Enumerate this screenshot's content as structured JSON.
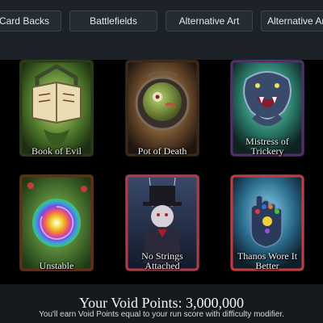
{
  "tabs": [
    "Card Backs",
    "Battlefields",
    "Alternative Art",
    "Alternative Art S"
  ],
  "cards": [
    {
      "title": "Book of Evil",
      "art": "evil-book-art",
      "color": "#6a9a3a"
    },
    {
      "title": "Pot of Death",
      "art": "cauldron-art",
      "color": "#8a6a3a"
    },
    {
      "title": "Mistress of Trickery",
      "art": "serpent-art",
      "color": "#3aa08a"
    },
    {
      "title": "Unstable",
      "art": "rainbow-vortex-art",
      "color": "#3a8a3a"
    },
    {
      "title": "No Strings Attached",
      "art": "puppet-art",
      "color": "#b03a4a"
    },
    {
      "title": "Thanos Wore It Better",
      "art": "gauntlet-art",
      "color": "#3a8aa8"
    }
  ],
  "footer": {
    "void_points": "Your Void Points: 3,000,000",
    "hint": "You'll earn Void Points equal to your run score with difficulty modifier."
  }
}
